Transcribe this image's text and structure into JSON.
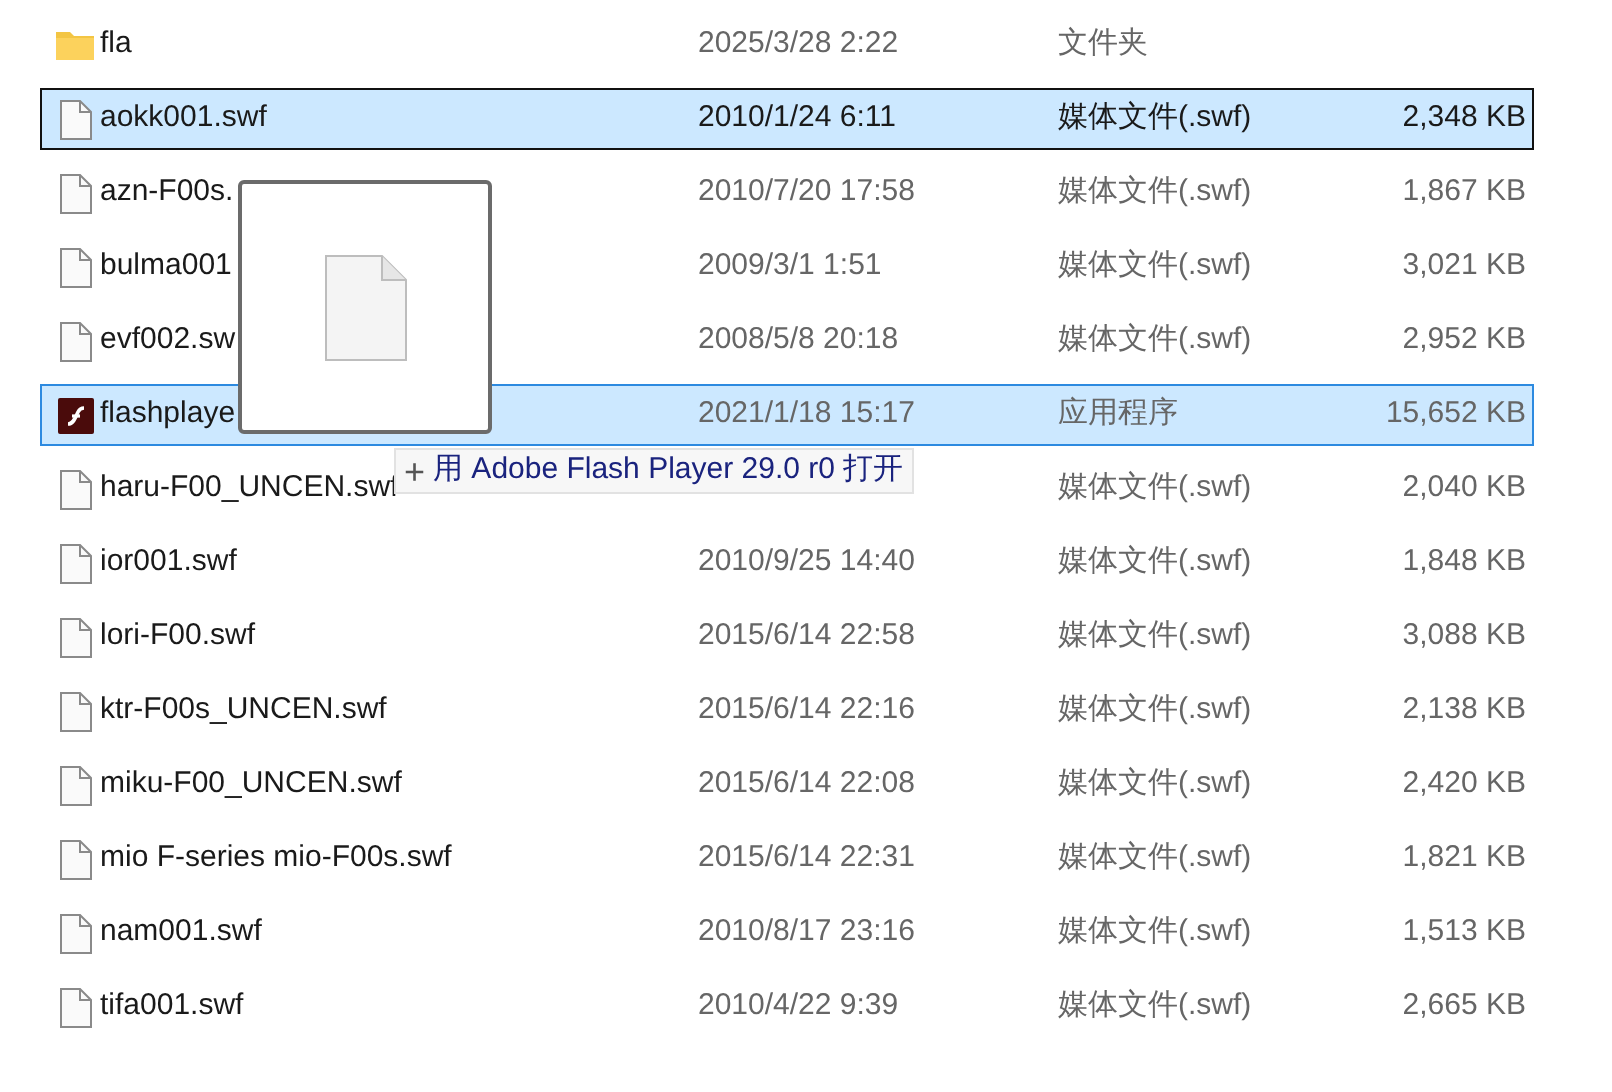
{
  "files": [
    {
      "kind": "folder",
      "name": "fla",
      "date": "2025/3/28 2:22",
      "type": "文件夹",
      "selected": false,
      "focused": false
    },
    {
      "kind": "file",
      "name": "aokk001.swf",
      "date": "2010/1/24 6:11",
      "type": "媒体文件(.swf)",
      "size": "2,348 KB",
      "selected": true,
      "focused": true
    },
    {
      "kind": "file",
      "name": "azn-F00s.",
      "date": "2010/7/20 17:58",
      "type": "媒体文件(.swf)",
      "size": "1,867 KB",
      "selected": false,
      "focused": false
    },
    {
      "kind": "file",
      "name": "bulma001",
      "date": "2009/3/1 1:51",
      "type": "媒体文件(.swf)",
      "size": "3,021 KB",
      "selected": false,
      "focused": false
    },
    {
      "kind": "file",
      "name": "evf002.sw",
      "date": "2008/5/8 20:18",
      "type": "媒体文件(.swf)",
      "size": "2,952 KB",
      "selected": false,
      "focused": false
    },
    {
      "kind": "app",
      "name": "flashplaye",
      "date": "2021/1/18 15:17",
      "type": "应用程序",
      "size": "15,652 KB",
      "selected": true,
      "focused": false
    },
    {
      "kind": "file",
      "name": "haru-F00_UNCEN.swf",
      "type": "媒体文件(.swf)",
      "size": "2,040 KB",
      "selected": false,
      "focused": false
    },
    {
      "kind": "file",
      "name": "ior001.swf",
      "date": "2010/9/25 14:40",
      "type": "媒体文件(.swf)",
      "size": "1,848 KB",
      "selected": false,
      "focused": false
    },
    {
      "kind": "file",
      "name": "lori-F00.swf",
      "date": "2015/6/14 22:58",
      "type": "媒体文件(.swf)",
      "size": "3,088 KB",
      "selected": false,
      "focused": false
    },
    {
      "kind": "file",
      "name": "ktr-F00s_UNCEN.swf",
      "date": "2015/6/14 22:16",
      "type": "媒体文件(.swf)",
      "size": "2,138 KB",
      "selected": false,
      "focused": false
    },
    {
      "kind": "file",
      "name": "miku-F00_UNCEN.swf",
      "date": "2015/6/14 22:08",
      "type": "媒体文件(.swf)",
      "size": "2,420 KB",
      "selected": false,
      "focused": false
    },
    {
      "kind": "file",
      "name": "mio F-series mio-F00s.swf",
      "date": "2015/6/14 22:31",
      "type": "媒体文件(.swf)",
      "size": "1,821 KB",
      "selected": false,
      "focused": false
    },
    {
      "kind": "file",
      "name": "nam001.swf",
      "date": "2010/8/17 23:16",
      "type": "媒体文件(.swf)",
      "size": "1,513 KB",
      "selected": false,
      "focused": false
    },
    {
      "kind": "file",
      "name": "tifa001.swf",
      "date": "2010/4/22 9:39",
      "type": "媒体文件(.swf)",
      "size": "2,665 KB",
      "selected": false,
      "focused": false
    }
  ],
  "drag_tooltip": {
    "symbol": "+",
    "text": "用 Adobe Flash Player 29.0 r0 打开"
  }
}
